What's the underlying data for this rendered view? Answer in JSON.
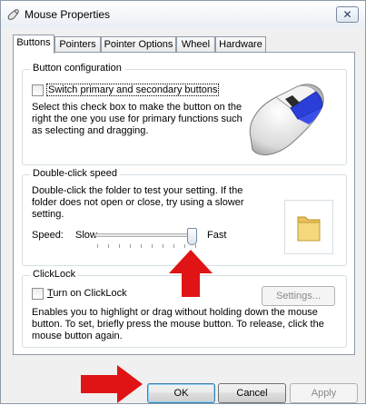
{
  "window": {
    "title": "Mouse Properties",
    "close_label": "✕"
  },
  "tabs": [
    {
      "label": "Buttons",
      "active": true
    },
    {
      "label": "Pointers",
      "active": false
    },
    {
      "label": "Pointer Options",
      "active": false
    },
    {
      "label": "Wheel",
      "active": false
    },
    {
      "label": "Hardware",
      "active": false
    }
  ],
  "button_configuration": {
    "title": "Button configuration",
    "switch_checkbox_label": "Switch primary and secondary buttons",
    "switch_checked": false,
    "description_lines": [
      "Select this check box to make the button on the",
      "right the one you use for primary functions such",
      "as selecting and dragging."
    ]
  },
  "double_click": {
    "title": "Double-click speed",
    "description_lines": [
      "Double-click the folder to test your setting. If the",
      "folder does not open or close, try using a slower",
      "setting."
    ],
    "speed_label": "Speed:",
    "slow_label": "Slow",
    "fast_label": "Fast",
    "slider_position_fraction": 0.9
  },
  "clicklock": {
    "title": "ClickLock",
    "checkbox_label_prefix": "T",
    "checkbox_label_rest": "urn on ClickLock",
    "checked": false,
    "settings_button": "Settings...",
    "description_lines": [
      "Enables you to highlight or drag without holding down the mouse",
      "button. To set, briefly press the mouse button. To release, click the",
      "mouse button again."
    ]
  },
  "footer": {
    "ok_label": "OK",
    "cancel_label": "Cancel",
    "apply_label": "Apply"
  },
  "colors": {
    "annotation_arrow": "#e01414"
  }
}
